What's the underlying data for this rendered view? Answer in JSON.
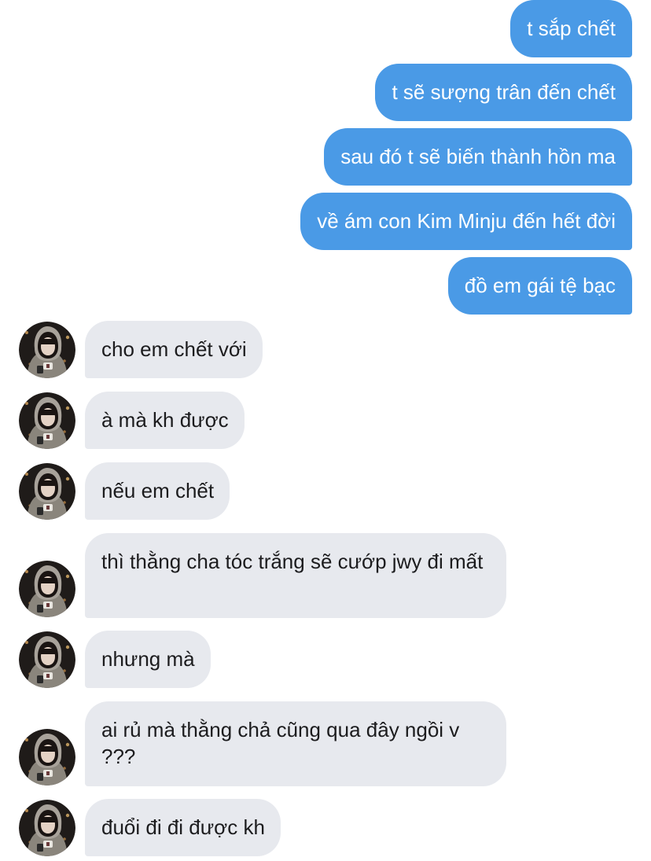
{
  "messages": [
    {
      "id": "m1",
      "direction": "outgoing",
      "text": "t sắp chết"
    },
    {
      "id": "m2",
      "direction": "outgoing",
      "text": "t sẽ sượng trân đến chết"
    },
    {
      "id": "m3",
      "direction": "outgoing",
      "text": "sau đó t sẽ biến thành hồn ma"
    },
    {
      "id": "m4",
      "direction": "outgoing",
      "text": "về ám con Kim Minju đến hết đời"
    },
    {
      "id": "m5",
      "direction": "outgoing",
      "text": "đồ em gái tệ bạc"
    },
    {
      "id": "m6",
      "direction": "incoming",
      "text": "cho em chết với"
    },
    {
      "id": "m7",
      "direction": "incoming",
      "text": "à mà kh được"
    },
    {
      "id": "m8",
      "direction": "incoming",
      "text": "nếu em chết"
    },
    {
      "id": "m9",
      "direction": "incoming",
      "text": "thì thằng cha tóc trắng sẽ cướp jwy đi mất"
    },
    {
      "id": "m10",
      "direction": "incoming",
      "text": "nhưng mà"
    },
    {
      "id": "m11",
      "direction": "incoming",
      "text": "ai rủ mà thằng chả cũng qua đây ngồi v ???"
    },
    {
      "id": "m12",
      "direction": "incoming",
      "text": "đuổi đi đi được kh"
    }
  ],
  "colors": {
    "outgoing_bubble": "#4a9ae6",
    "outgoing_text": "#ffffff",
    "incoming_bubble": "#e7e9ee",
    "incoming_text": "#1c1c1e",
    "background": "#ffffff"
  },
  "contact": {
    "avatar_icon": "contact-avatar-photo"
  }
}
